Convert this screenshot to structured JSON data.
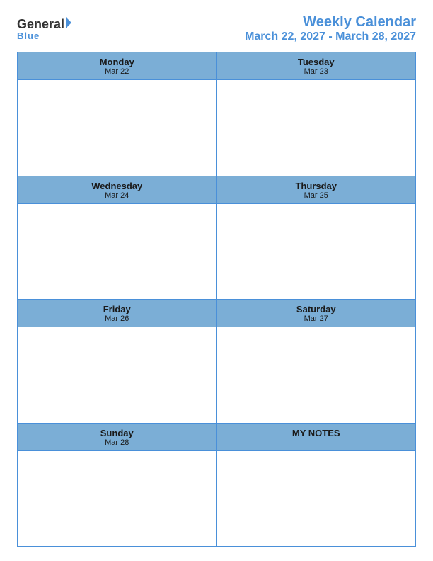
{
  "logo": {
    "general": "General",
    "blue": "Blue",
    "tagline": "Blue"
  },
  "title": {
    "main": "Weekly Calendar",
    "date_range": "March 22, 2027 - March 28, 2027"
  },
  "days": [
    {
      "name": "Monday",
      "date": "Mar 22"
    },
    {
      "name": "Tuesday",
      "date": "Mar 23"
    },
    {
      "name": "Wednesday",
      "date": "Mar 24"
    },
    {
      "name": "Thursday",
      "date": "Mar 25"
    },
    {
      "name": "Friday",
      "date": "Mar 26"
    },
    {
      "name": "Saturday",
      "date": "Mar 27"
    },
    {
      "name": "Sunday",
      "date": "Mar 28"
    }
  ],
  "notes": {
    "label": "MY NOTES"
  },
  "colors": {
    "header_bg": "#7baed6",
    "border": "#4a90d9",
    "title": "#4a90d9"
  }
}
